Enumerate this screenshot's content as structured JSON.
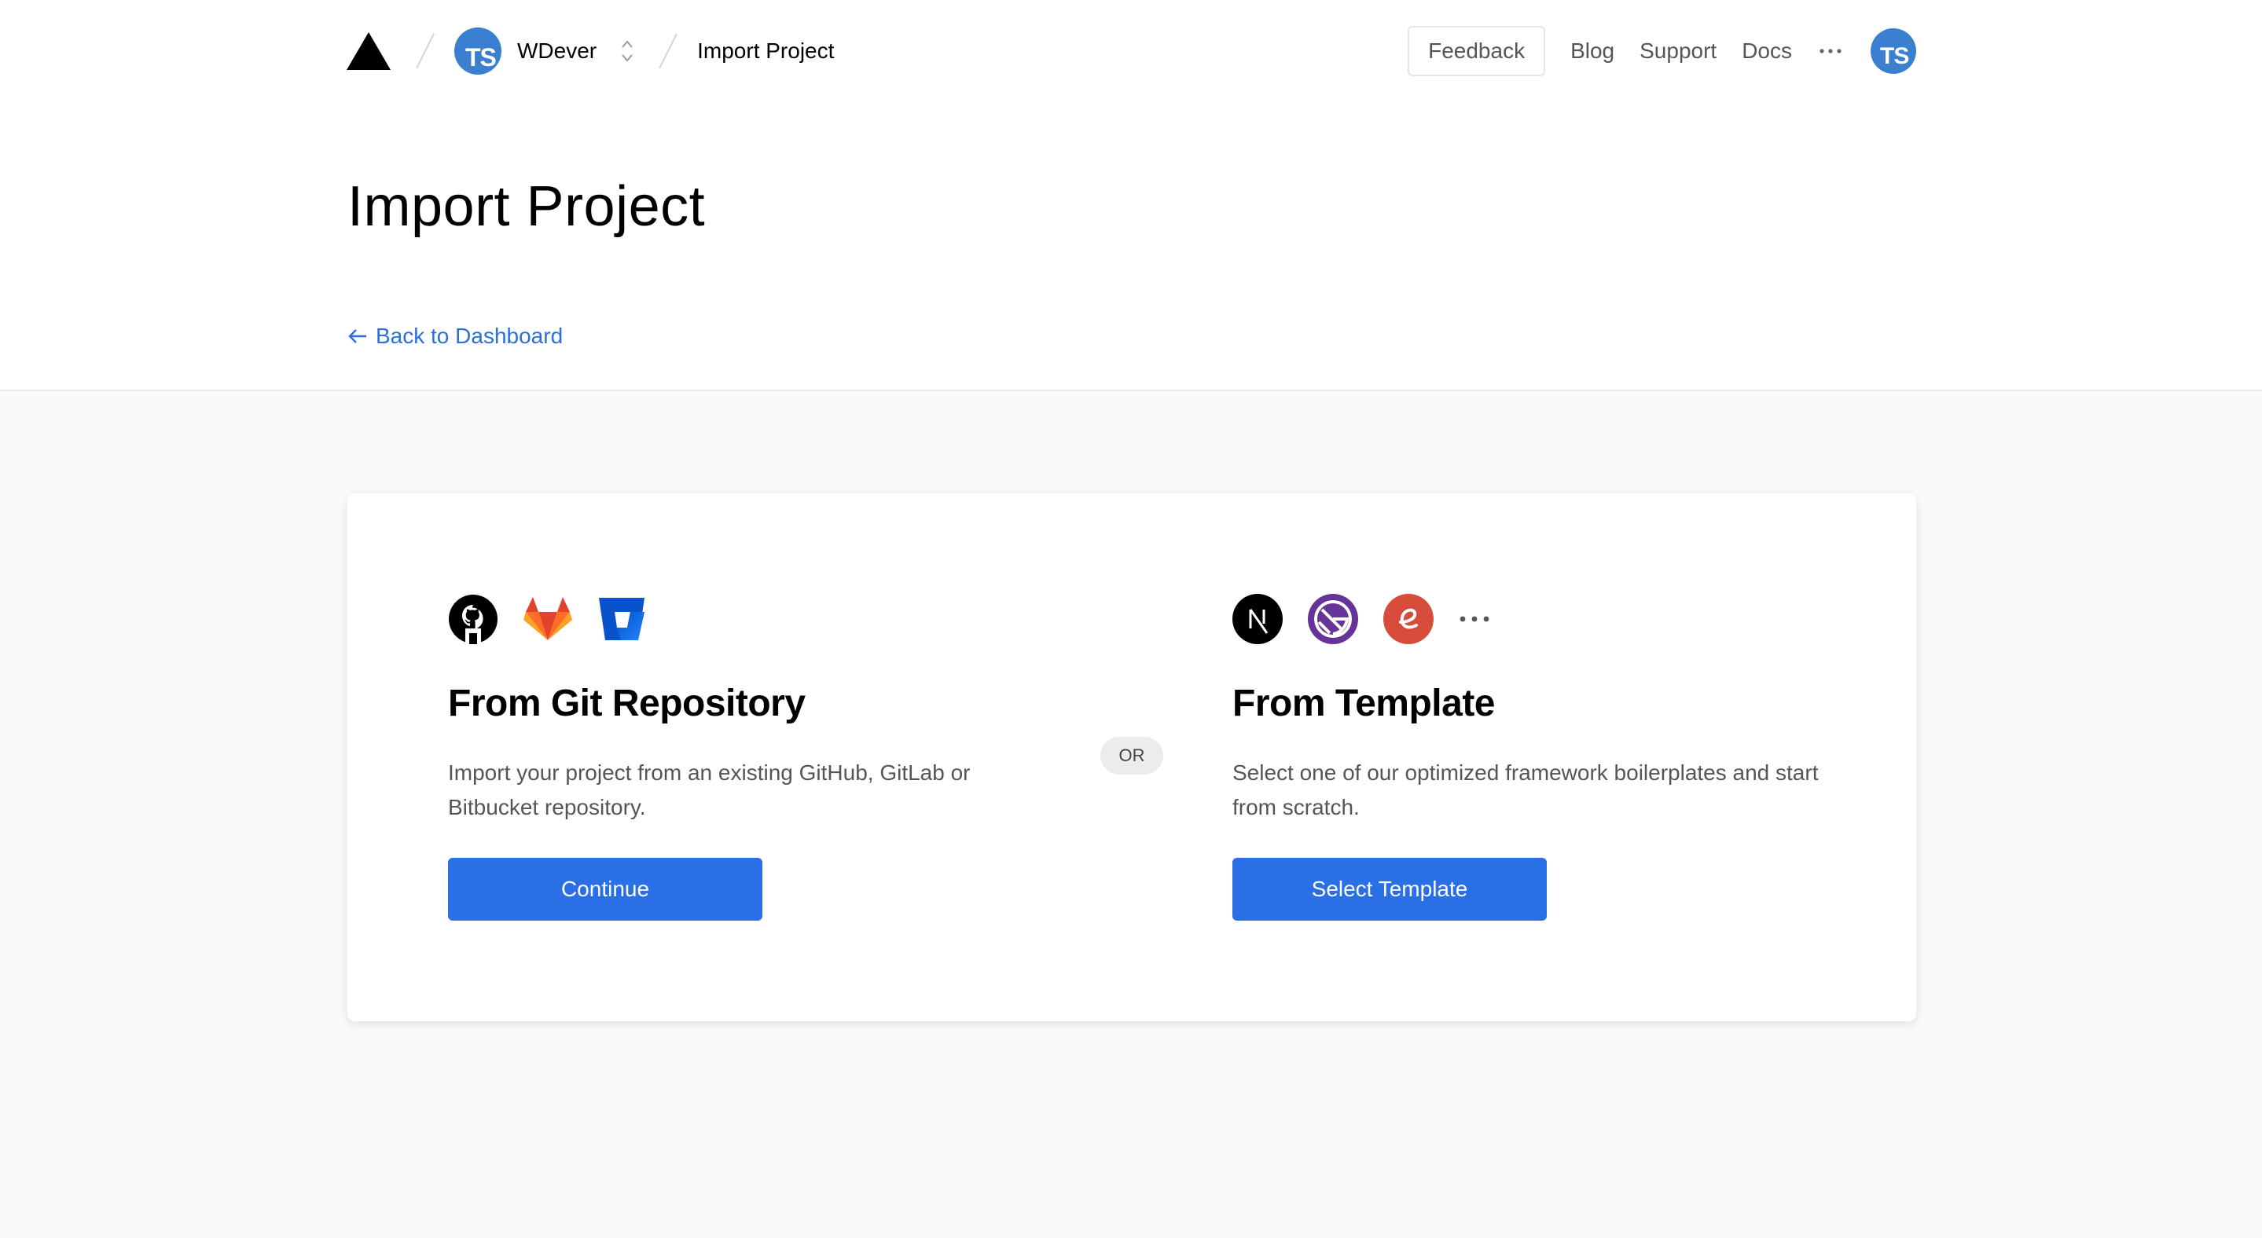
{
  "nav": {
    "team_avatar_initials": "TS",
    "team_name": "WDever",
    "breadcrumb": "Import Project",
    "feedback_label": "Feedback",
    "links": [
      "Blog",
      "Support",
      "Docs"
    ],
    "user_avatar_initials": "TS"
  },
  "page": {
    "title": "Import Project",
    "back_link": "Back to Dashboard"
  },
  "git_option": {
    "icons": [
      "github-icon",
      "gitlab-icon",
      "bitbucket-icon"
    ],
    "title": "From Git Repository",
    "description": "Import your project from an existing GitHub, GitLab or Bitbucket repository.",
    "button_label": "Continue"
  },
  "divider_label": "OR",
  "template_option": {
    "icons": [
      "nextjs-icon",
      "gatsby-icon",
      "eleventy-icon",
      "more-icon"
    ],
    "title": "From Template",
    "description": "Select one of our optimized framework boilerplates and start from scratch.",
    "button_label": "Select Template"
  },
  "colors": {
    "accent": "#2b6fe6",
    "link": "#2a6fdb",
    "avatar": "#3b7fd1",
    "page_background": "#fafafa"
  }
}
